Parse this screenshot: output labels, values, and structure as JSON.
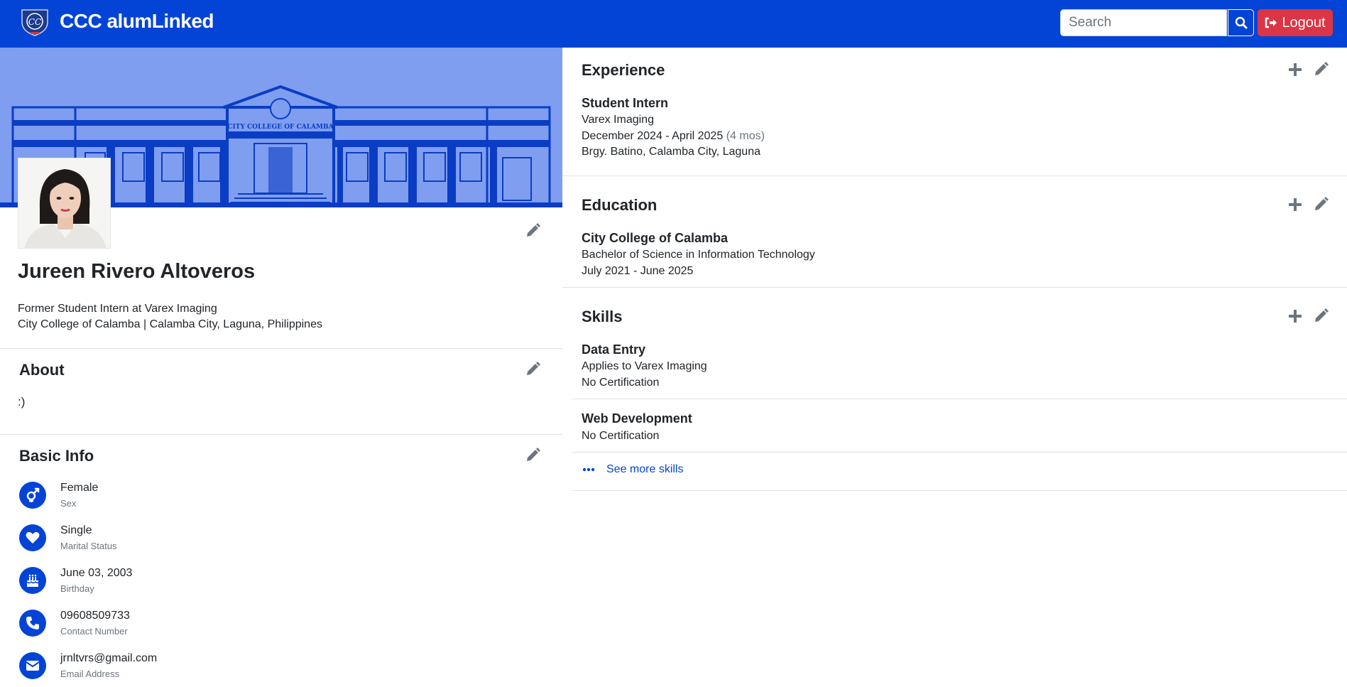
{
  "navbar": {
    "brand": "CCC alumLinked",
    "search_placeholder": "Search",
    "logout_label": "Logout"
  },
  "cover": {
    "school_sign": "CITY COLLEGE OF CALAMBA"
  },
  "profile": {
    "name": "Jureen Rivero Altoveros",
    "headline": "Former Student Intern at Varex Imaging",
    "location": "City College of Calamba | Calamba City, Laguna, Philippines"
  },
  "about": {
    "title": "About",
    "text": ":)"
  },
  "basic_info": {
    "title": "Basic Info",
    "items": [
      {
        "value": "Female",
        "label": "Sex",
        "icon": "gender-icon"
      },
      {
        "value": "Single",
        "label": "Marital Status",
        "icon": "heart-icon"
      },
      {
        "value": "June 03, 2003",
        "label": "Birthday",
        "icon": "cake-icon"
      },
      {
        "value": "09608509733",
        "label": "Contact Number",
        "icon": "phone-icon"
      },
      {
        "value": "jrnltvrs@gmail.com",
        "label": "Email Address",
        "icon": "envelope-icon"
      }
    ]
  },
  "experience": {
    "title": "Experience",
    "items": [
      {
        "position": "Student Intern",
        "company": "Varex Imaging",
        "dates": "December 2024 - April 2025",
        "duration": "(4 mos)",
        "address": "Brgy. Batino, Calamba City, Laguna"
      }
    ]
  },
  "education": {
    "title": "Education",
    "items": [
      {
        "school": "City College of Calamba",
        "degree": "Bachelor of Science in Information Technology",
        "dates": "July 2021 - June 2025"
      }
    ]
  },
  "skills": {
    "title": "Skills",
    "items": [
      {
        "name": "Data Entry",
        "applies_to": "Applies to Varex Imaging",
        "certification": "No Certification"
      },
      {
        "name": "Web Development",
        "certification": "No Certification"
      }
    ],
    "see_more_label": "See more skills"
  },
  "colors": {
    "primary": "#0344d6",
    "cover_bg": "#7f9ef0",
    "danger": "#dc3545",
    "icon_gray": "#6c757d"
  }
}
